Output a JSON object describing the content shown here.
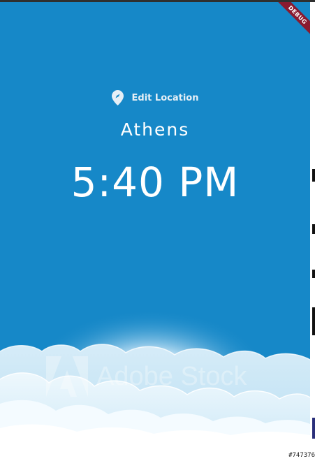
{
  "location": {
    "edit_label": "Edit Location",
    "icon": "location-pin-icon"
  },
  "city": "Athens",
  "time": "5:40 PM",
  "background": {
    "sky_color": "#1688c8",
    "watermark_text": "Adobe Stock",
    "stock_id": "#747376"
  },
  "debug_banner": "DEBUG"
}
